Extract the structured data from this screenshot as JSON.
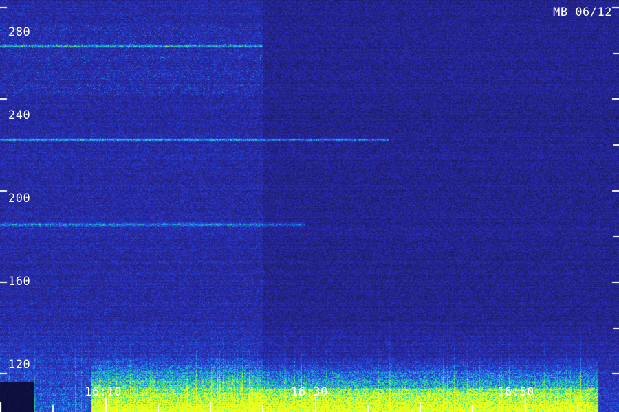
{
  "station_label": "MB 06/12",
  "colors": {
    "background_low": "#0b0b3c",
    "background_high": "#2a2ac0",
    "mid": "#1c6fe0",
    "high": "#20e0c0",
    "peak": "#e8ff20",
    "tick": "#ffffff"
  },
  "chart_data": {
    "type": "heatmap",
    "title": "",
    "xlabel": "",
    "ylabel": "",
    "y_tick_labels": [
      "280",
      "240",
      "200",
      "160",
      "120"
    ],
    "y_ticks": [
      280,
      240,
      200,
      160,
      120
    ],
    "x_tick_labels": [
      "16:10",
      "16:30",
      "16:50"
    ],
    "x_ticks": [
      "16:10",
      "16:30",
      "16:50"
    ],
    "ylim": [
      103,
      283
    ],
    "xlim": [
      "16:00",
      "16:59"
    ],
    "minor_x_tick_interval_minutes": 5,
    "features": [
      {
        "name": "persistent band",
        "y": 263,
        "x_start": "16:00",
        "x_end": "16:25"
      },
      {
        "name": "persistent band",
        "y": 222,
        "x_start": "16:00",
        "x_end": "16:37"
      },
      {
        "name": "persistent band",
        "y": 185,
        "x_start": "16:00",
        "x_end": "16:29"
      },
      {
        "name": "low-frequency emission",
        "y_min": 103,
        "y_max": 127,
        "x_start": "16:10",
        "x_end": "16:57"
      }
    ],
    "grid": false,
    "legend": "none"
  }
}
